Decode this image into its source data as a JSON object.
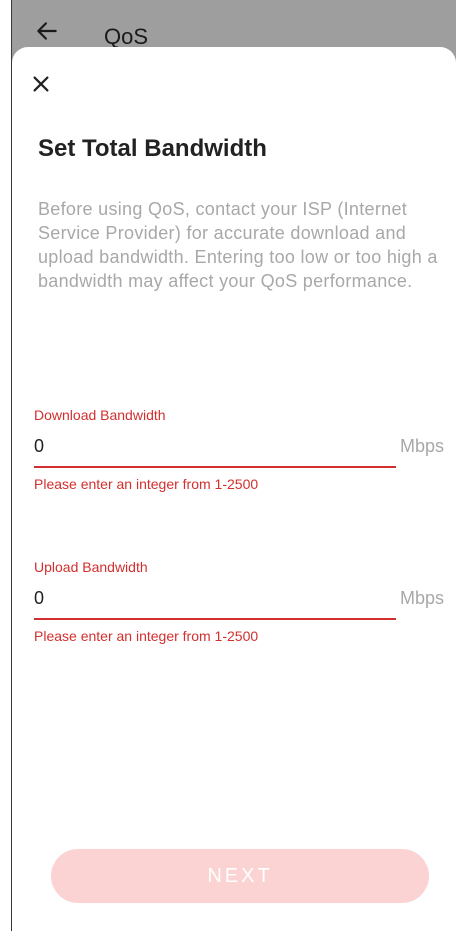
{
  "header": {
    "title": "QoS",
    "back_icon": "arrow-left-icon"
  },
  "sheet": {
    "close_icon": "close-icon",
    "title": "Set Total Bandwidth",
    "description": "Before using QoS, contact your ISP (Internet Service Provider) for accurate download and upload bandwidth. Entering too low or too high a bandwidth may affect your QoS performance."
  },
  "download": {
    "label": "Download Bandwidth",
    "value": "0",
    "unit": "Mbps",
    "error": "Please enter an integer from 1-2500"
  },
  "upload": {
    "label": "Upload Bandwidth",
    "value": "0",
    "unit": "Mbps",
    "error": "Please enter an integer from 1-2500"
  },
  "actions": {
    "next_label": "NEXT"
  },
  "colors": {
    "accent_error": "#d32f2f",
    "button_disabled": "#fbd3d3",
    "backdrop": "#9e9e9e",
    "muted_text": "#a8a8a8"
  }
}
